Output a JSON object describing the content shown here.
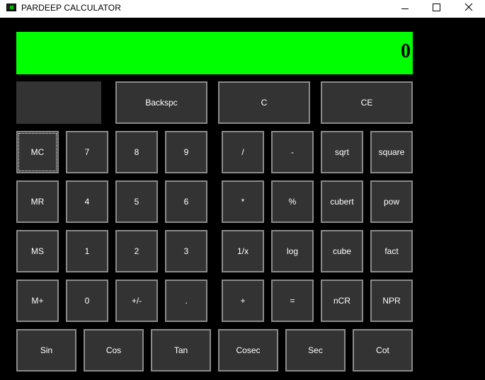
{
  "window": {
    "title": "PARDEEP CALCULATOR",
    "icon": "calculator-app-icon",
    "controls": [
      "minimize-icon",
      "maximize-icon",
      "close-icon"
    ]
  },
  "display": {
    "value": "0",
    "background_color": "#00ff00",
    "text_color": "#000000"
  },
  "colors": {
    "window_background": "#000000",
    "button_background": "#333333",
    "button_border": "#8a8a8a",
    "button_text": "#ffffff"
  },
  "buttons": {
    "backspace": "Backspc",
    "clear": "C",
    "clear_entry": "CE",
    "mc": "MC",
    "mr": "MR",
    "ms": "MS",
    "mplus": "M+",
    "d7": "7",
    "d8": "8",
    "d9": "9",
    "d4": "4",
    "d5": "5",
    "d6": "6",
    "d1": "1",
    "d2": "2",
    "d3": "3",
    "d0": "0",
    "plusminus": "+/-",
    "dot": ".",
    "divide": "/",
    "minus": "-",
    "sqrt": "sqrt",
    "square": "square",
    "multiply": "*",
    "percent": "%",
    "cubert": "cubert",
    "pow": "pow",
    "reciprocal": "1/x",
    "log": "log",
    "cube": "cube",
    "fact": "fact",
    "plus": "+",
    "equals": "=",
    "ncr": "nCR",
    "npr": "NPR",
    "sin": "Sin",
    "cos": "Cos",
    "tan": "Tan",
    "cosec": "Cosec",
    "sec": "Sec",
    "cot": "Cot"
  }
}
